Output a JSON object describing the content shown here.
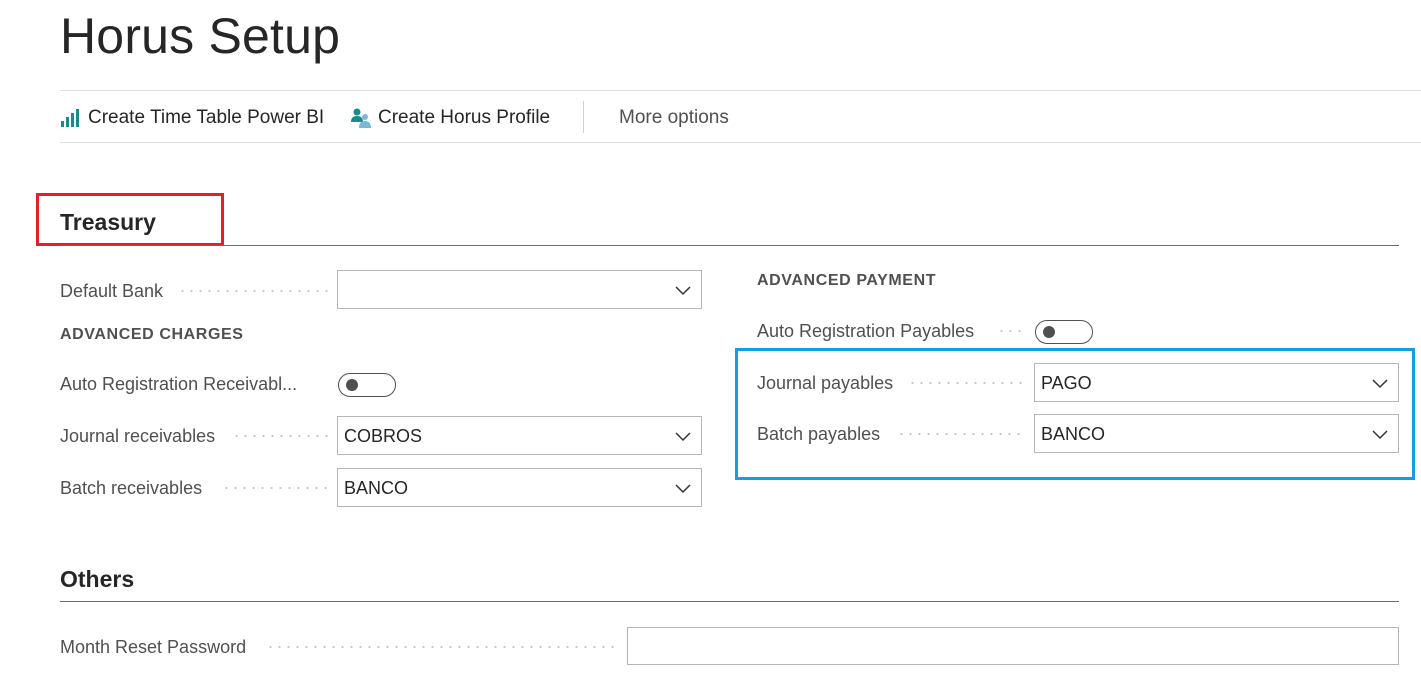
{
  "page": {
    "title": "Horus Setup"
  },
  "actions": {
    "create_time_table": "Create Time Table Power BI",
    "create_profile": "Create Horus Profile",
    "more_options": "More options"
  },
  "treasury": {
    "title": "Treasury",
    "default_bank": {
      "label": "Default Bank",
      "value": ""
    },
    "advanced_charges": {
      "heading": "ADVANCED CHARGES",
      "auto_registration": {
        "label": "Auto Registration Receivabl...",
        "enabled": false
      },
      "journal": {
        "label": "Journal receivables",
        "value": "COBROS"
      },
      "batch": {
        "label": "Batch receivables",
        "value": "BANCO"
      }
    },
    "advanced_payment": {
      "heading": "ADVANCED PAYMENT",
      "auto_registration": {
        "label": "Auto Registration Payables",
        "enabled": false
      },
      "journal": {
        "label": "Journal payables",
        "value": "PAGO"
      },
      "batch": {
        "label": "Batch payables",
        "value": "BANCO"
      }
    }
  },
  "others": {
    "title": "Others",
    "month_reset_password": {
      "label": "Month Reset Password",
      "value": ""
    }
  },
  "colors": {
    "red_highlight": "#e0202a",
    "blue_highlight": "#149ee0",
    "icon_teal": "#1a8a8a"
  }
}
